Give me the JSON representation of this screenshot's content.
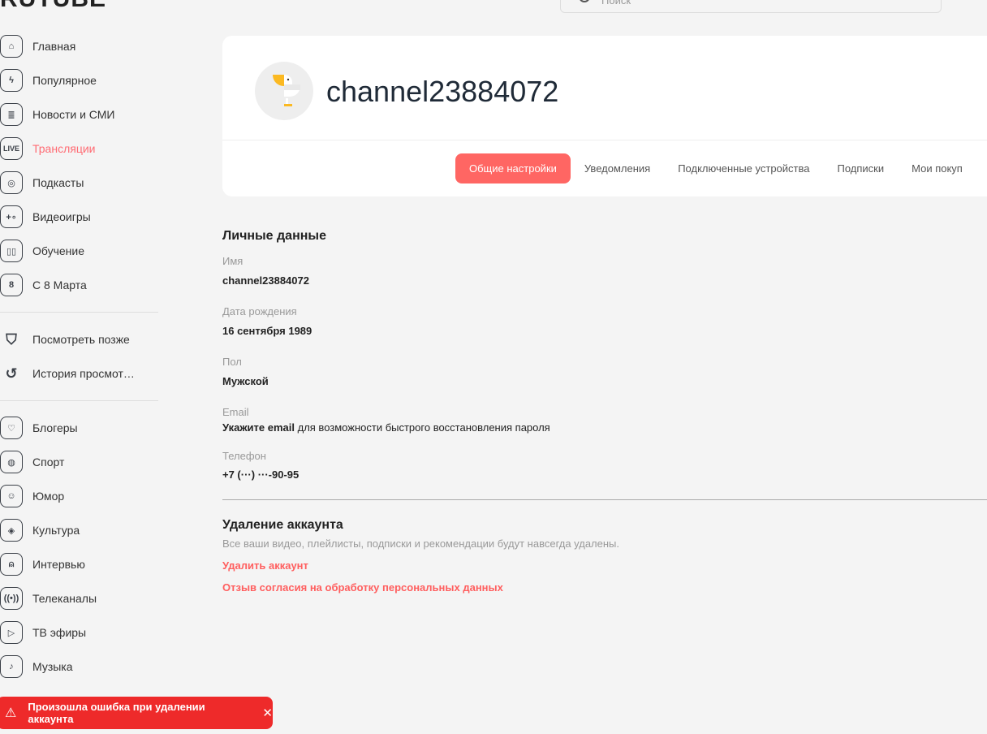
{
  "header": {
    "logo": "RUTUBE",
    "search_placeholder": "Поиск"
  },
  "sidebar": {
    "groups": [
      [
        {
          "label": "Главная",
          "icon": "home-icon"
        },
        {
          "label": "Популярное",
          "icon": "lightning-icon"
        },
        {
          "label": "Новости и СМИ",
          "icon": "news-icon"
        },
        {
          "label": "Трансляции",
          "icon": "live-icon",
          "active": true
        },
        {
          "label": "Подкасты",
          "icon": "microphone-icon"
        },
        {
          "label": "Видеоигры",
          "icon": "gamepad-icon"
        },
        {
          "label": "Обучение",
          "icon": "book-icon"
        },
        {
          "label": "С 8 Марта",
          "icon": "eight-icon"
        }
      ],
      [
        {
          "label": "Посмотреть позже",
          "icon": "bookmark-icon"
        },
        {
          "label": "История просмот…",
          "icon": "history-icon"
        }
      ],
      [
        {
          "label": "Блогеры",
          "icon": "heart-icon"
        },
        {
          "label": "Спорт",
          "icon": "ball-icon"
        },
        {
          "label": "Юмор",
          "icon": "smile-icon"
        },
        {
          "label": "Культура",
          "icon": "theatre-icon"
        },
        {
          "label": "Интервью",
          "icon": "person-icon"
        },
        {
          "label": "Телеканалы",
          "icon": "broadcast-icon"
        },
        {
          "label": "ТВ эфиры",
          "icon": "tv-icon"
        },
        {
          "label": "Музыка",
          "icon": "music-icon"
        }
      ]
    ]
  },
  "profile": {
    "name": "channel23884072"
  },
  "tabs": [
    "Общие настройки",
    "Уведомления",
    "Подключенные устройства",
    "Подписки",
    "Мои покуп"
  ],
  "personal": {
    "heading": "Личные данные",
    "name_label": "Имя",
    "name": "channel23884072",
    "birth_label": "Дата рождения",
    "birth": "16 сентября 1989",
    "gender_label": "Пол",
    "gender": "Мужской",
    "email_label": "Email",
    "email_link": "Укажите email",
    "email_hint": " для возможности быстрого восстановления пароля",
    "phone_label": "Телефон",
    "phone": "+7 (···) ···-90-95"
  },
  "deletion": {
    "heading": "Удаление аккаунта",
    "description": "Все ваши видео, плейлисты, подписки и рекомендации будут навсегда удалены.",
    "delete_link": "Удалить аккаунт",
    "consent_link": "Отзыв согласия на обработку персональных данных"
  },
  "toast": {
    "message": "Произошла ошибка при удалении аккаунта"
  },
  "colors": {
    "accent": "#ff6663",
    "error": "#ee2a2a",
    "active_nav": "#ff6b73"
  }
}
